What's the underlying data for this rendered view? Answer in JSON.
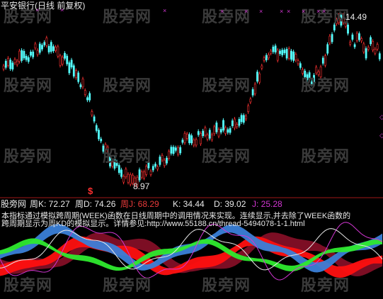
{
  "price_panel": {
    "title": "平安银行(日线 前复权)",
    "high_label": "14.49",
    "low_label": "8.97",
    "signal_marker": "$",
    "watermark": "股旁网",
    "colors": {
      "up_candle": "#ff3232",
      "down_candle": "#54fcfc",
      "marker": "#d236d2"
    }
  },
  "indicator_panel": {
    "title": "股旁网",
    "weekly_k": "周K: 72.27",
    "weekly_d": "周D: 74.26",
    "weekly_j": "周J: 68.29",
    "k": "K: 34.44",
    "d": "D: 39.02",
    "j": "J: 25.28",
    "note_line_1": "本指标通过模拟跨周期(WEEK)函数在日线周期中的调用情况来实现。连续显示,并去除了WEEK函数的",
    "note_line_2": "跨周期显示为周KD的模拟显示。详情参见:http://www.55188.cn/thread-5494078-1-1.html",
    "colors": {
      "green_band": "#2eea2e",
      "blue_band": "#3a7fd8",
      "red_band": "#ff1010",
      "purple_line": "#d236d2"
    }
  }
}
